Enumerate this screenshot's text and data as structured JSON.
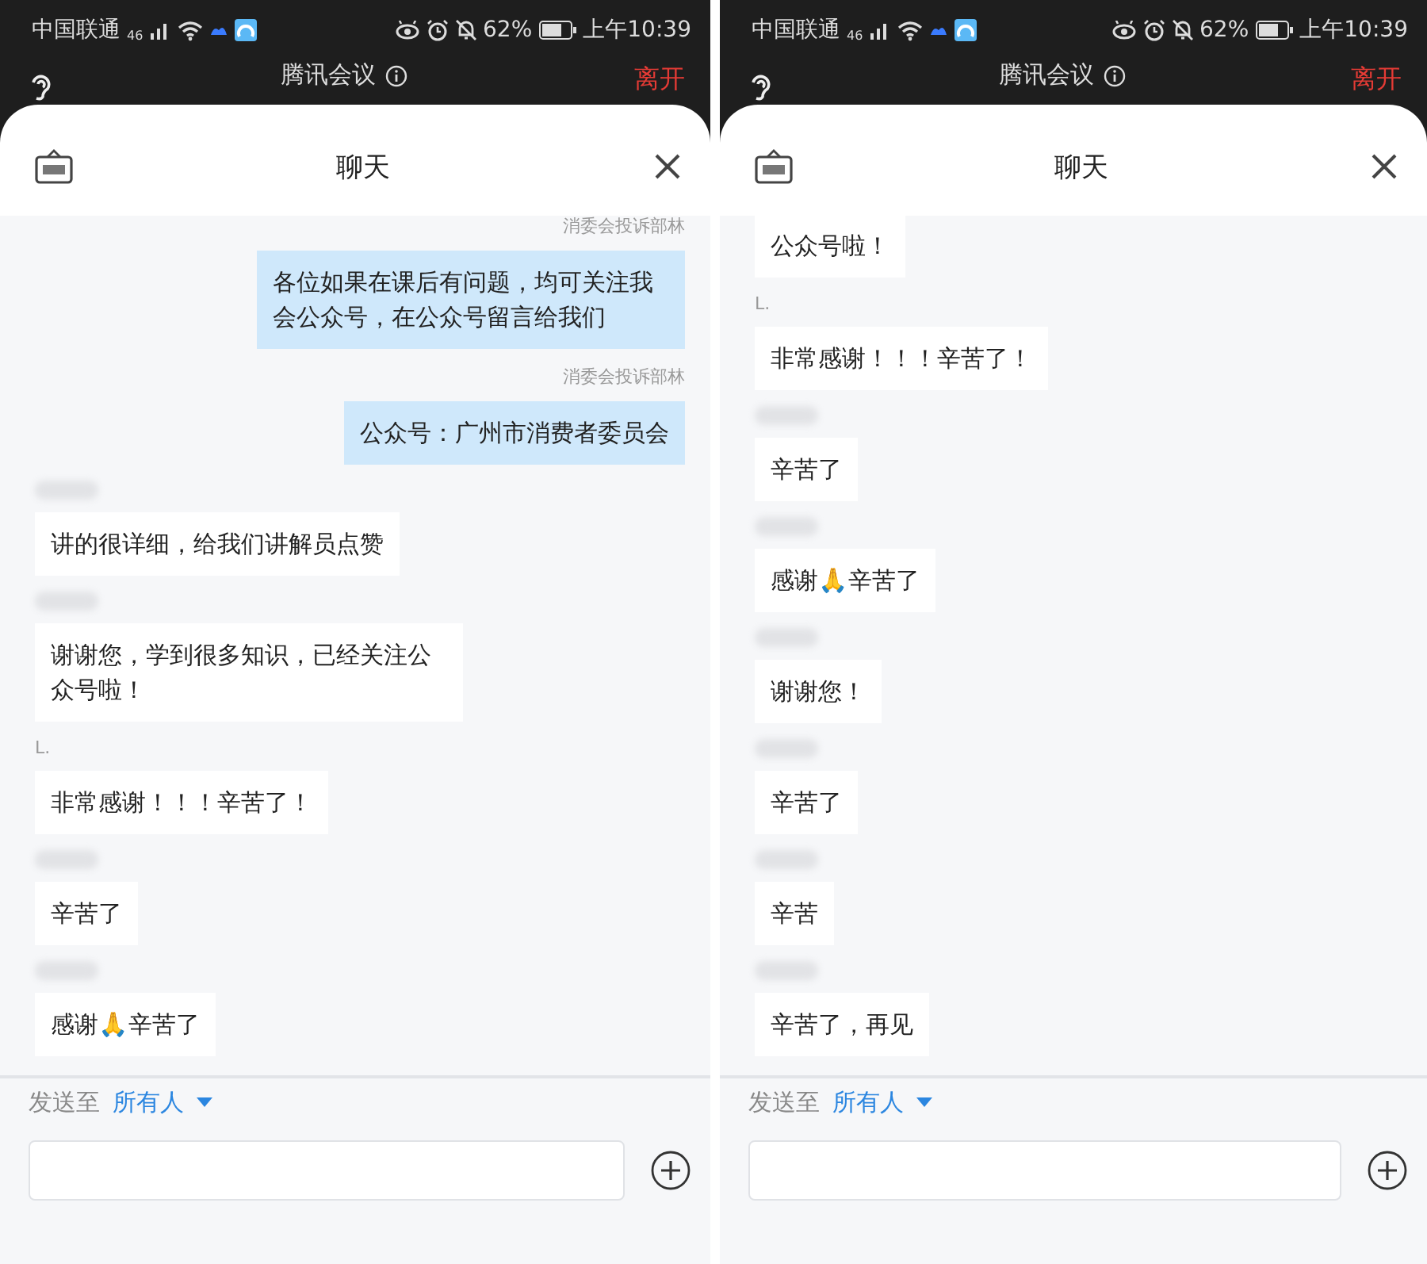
{
  "screens": [
    {
      "status_bar": {
        "carrier": "中国联通",
        "network": "46",
        "battery": "62%",
        "time": "上午10:39"
      },
      "app_bar": {
        "title": "腾讯会议",
        "leave": "离开"
      },
      "chat": {
        "title": "聊天",
        "messages": [
          {
            "kind": "self",
            "sender": "消委会投诉部林",
            "text": "各位如果在课后有问题，均可关注我会公众号，在公众号留言给我们"
          },
          {
            "kind": "self",
            "sender": "消委会投诉部林",
            "text": "公众号：广州市消费者委员会"
          },
          {
            "kind": "other",
            "text": "讲的很详细，给我们讲解员点赞"
          },
          {
            "kind": "other",
            "text": "谢谢您，学到很多知识，已经关注公众号啦！"
          },
          {
            "kind": "other",
            "sender": "L.",
            "text": "非常感谢！！！辛苦了！"
          },
          {
            "kind": "other",
            "text": "辛苦了"
          },
          {
            "kind": "other",
            "text": "感谢🙏辛苦了"
          }
        ]
      },
      "composer": {
        "send_to_label": "发送至",
        "recipient": "所有人"
      }
    },
    {
      "status_bar": {
        "carrier": "中国联通",
        "network": "46",
        "battery": "62%",
        "time": "上午10:39"
      },
      "app_bar": {
        "title": "腾讯会议",
        "leave": "离开"
      },
      "chat": {
        "title": "聊天",
        "messages": [
          {
            "kind": "other",
            "text": "公众号啦！"
          },
          {
            "kind": "other",
            "sender": "L.",
            "text": "非常感谢！！！辛苦了！"
          },
          {
            "kind": "other",
            "text": "辛苦了"
          },
          {
            "kind": "other",
            "text": "感谢🙏辛苦了"
          },
          {
            "kind": "other",
            "text": "谢谢您！"
          },
          {
            "kind": "other",
            "text": "辛苦了"
          },
          {
            "kind": "other",
            "text": "辛苦"
          },
          {
            "kind": "other",
            "text": "辛苦了，再见"
          }
        ]
      },
      "composer": {
        "send_to_label": "发送至",
        "recipient": "所有人"
      }
    }
  ]
}
